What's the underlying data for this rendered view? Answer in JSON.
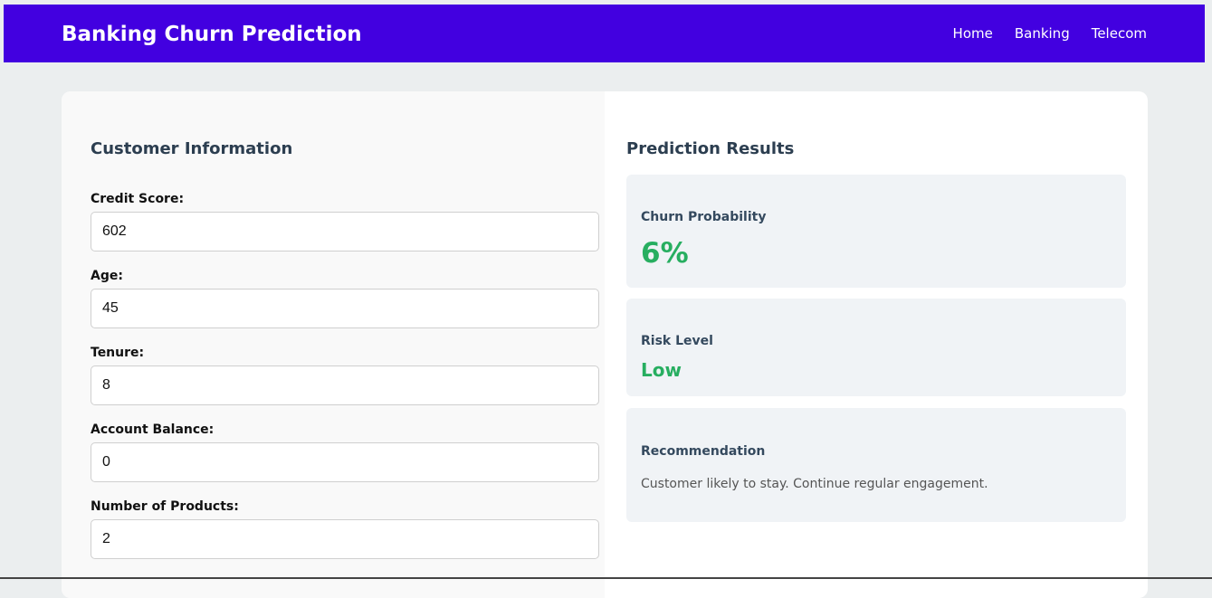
{
  "navbar": {
    "brand": "Banking Churn Prediction",
    "links": [
      "Home",
      "Banking",
      "Telecom"
    ]
  },
  "form": {
    "title": "Customer Information",
    "fields": [
      {
        "label": "Credit Score:",
        "value": "602"
      },
      {
        "label": "Age:",
        "value": "45"
      },
      {
        "label": "Tenure:",
        "value": "8"
      },
      {
        "label": "Account Balance:",
        "value": "0"
      },
      {
        "label": "Number of Products:",
        "value": "2"
      }
    ]
  },
  "results": {
    "title": "Prediction Results",
    "churn": {
      "label": "Churn Probability",
      "value": "6%"
    },
    "risk": {
      "label": "Risk Level",
      "value": "Low"
    },
    "recommendation": {
      "label": "Recommendation",
      "text": "Customer likely to stay. Continue regular engagement."
    }
  },
  "colors": {
    "navbar": "#4200e0",
    "positive": "#27ae60",
    "background": "#ebeeef"
  }
}
